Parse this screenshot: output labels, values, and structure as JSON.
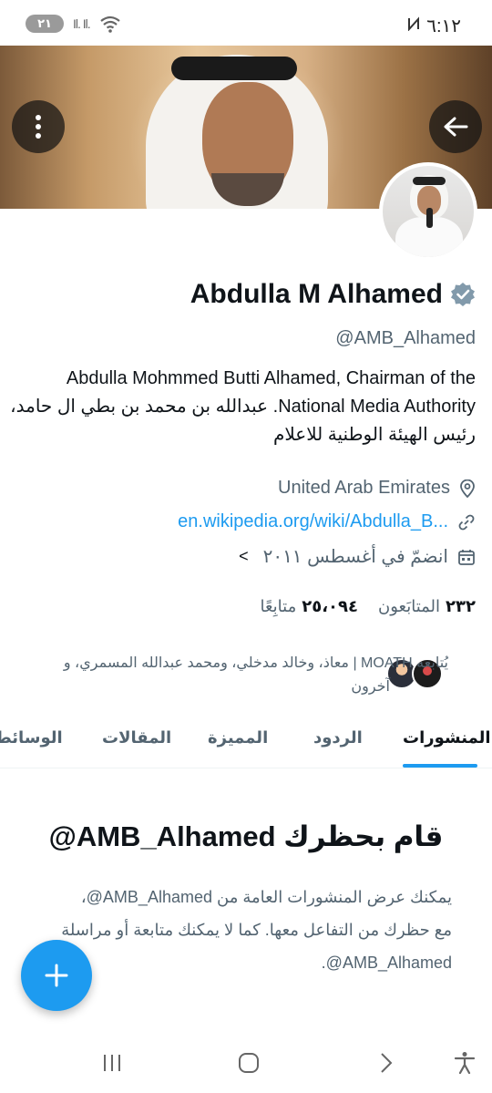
{
  "status_bar": {
    "time": "٦:١٢",
    "battery": "٢١",
    "signal_text": "Il. Il.",
    "icons": [
      "nfc-icon",
      "wifi-icon",
      "signal-icon",
      "battery-icon"
    ]
  },
  "header": {
    "back_icon": "arrow-left-icon",
    "more_icon": "more-vertical-icon"
  },
  "profile": {
    "display_name": "Abdulla M Alhamed",
    "verified_icon": "verified-badge-icon",
    "handle": "@AMB_Alhamed",
    "bio_lines": [
      "Abdulla Mohmmed Butti Alhamed, Chairman of the",
      "National Media Authority. عبدالله بن محمد بن بطي ال حامد،",
      "رئيس الهيئة الوطنية للاعلام"
    ],
    "location": "United Arab Emirates",
    "website": "en.wikipedia.org/wiki/Abdulla_B...",
    "joined": "انضمّ في أغسطس ٢٠١١",
    "following_count": "٢٣٢",
    "following_label": "المتابَعون",
    "followers_count": "٢٥،٠٩٤",
    "followers_label": "متابِعًا",
    "followed_by_line1": "يُتابعه MOATH | معاذ، وخالد مدخلي، ومحمد عبدالله المسمري، و",
    "followed_by_line2": "آخرون"
  },
  "tabs": [
    {
      "label": "المنشورات",
      "active": true
    },
    {
      "label": "الردود",
      "active": false
    },
    {
      "label": "المميزة",
      "active": false
    },
    {
      "label": "المقالات",
      "active": false
    },
    {
      "label": "الوسائط",
      "active": false
    }
  ],
  "blocked": {
    "title": "قام بحظرك AMB_Alhamed@",
    "message_lines": [
      "يمكنك عرض المنشورات العامة من AMB_Alhamed@،",
      "مع حظرك من التفاعل معها. كما لا يمكنك متابعة أو مراسلة",
      "AMB_Alhamed@."
    ]
  },
  "fab": {
    "icon": "plus-icon"
  },
  "nav": {
    "icons": [
      "recents-icon",
      "home-icon",
      "back-icon",
      "accessibility-icon"
    ]
  },
  "colors": {
    "accent": "#1d9bf0",
    "text": "#0f1419",
    "muted": "#536471",
    "verified": "#829aab"
  }
}
